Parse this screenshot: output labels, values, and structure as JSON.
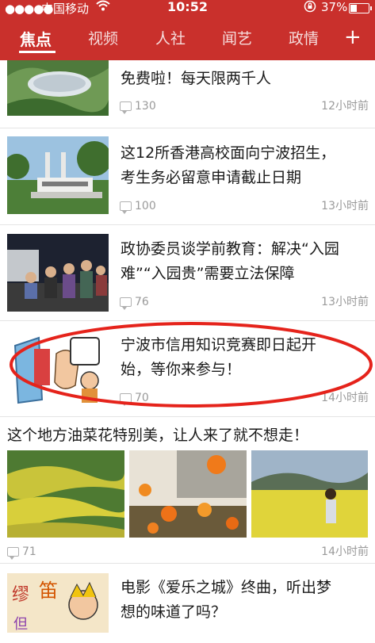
{
  "status_bar": {
    "carrier": "中国移动",
    "time": "10:52",
    "battery_percent": "37%",
    "battery_level": 0.37
  },
  "tabs": [
    {
      "label": "焦点",
      "active": true
    },
    {
      "label": "视频"
    },
    {
      "label": "人社"
    },
    {
      "label": "闻艺"
    },
    {
      "label": "政情"
    }
  ],
  "add_tab_label": "+",
  "feed": [
    {
      "title_line1": "免费啦！每天限两千人",
      "comments": "130",
      "time": "12小时前",
      "image": "radio-telescope-valley-icon"
    },
    {
      "title_line1": "这12所香港高校面向宁波招生，",
      "title_line2": "考生务必留意申请截止日期",
      "comments": "100",
      "time": "13小时前",
      "image": "university-gate-icon"
    },
    {
      "title_line1": "政协委员谈学前教育：解决“入园",
      "title_line2": "难”“入园贵”需要立法保障",
      "comments": "76",
      "time": "13小时前",
      "image": "parents-queue-night-icon"
    },
    {
      "title_line1": "宁波市信用知识竞赛即日起开",
      "title_line2": "始，等你来参与！",
      "comments": "70",
      "time": "14小时前",
      "image": "stop-sign-cartoon-icon"
    },
    {
      "title": "这个地方油菜花特别美，让人来了就不想走！",
      "comments": "71",
      "time": "14小时前",
      "images": [
        "terraced-rapeseed-fields-icon",
        "orange-flowers-icon",
        "girl-in-flower-field-icon"
      ]
    },
    {
      "title_line1": "电影《爱乐之城》终曲，听出梦",
      "title_line2": "想的味道了吗？",
      "image": "cartoon-poster-icon"
    }
  ]
}
